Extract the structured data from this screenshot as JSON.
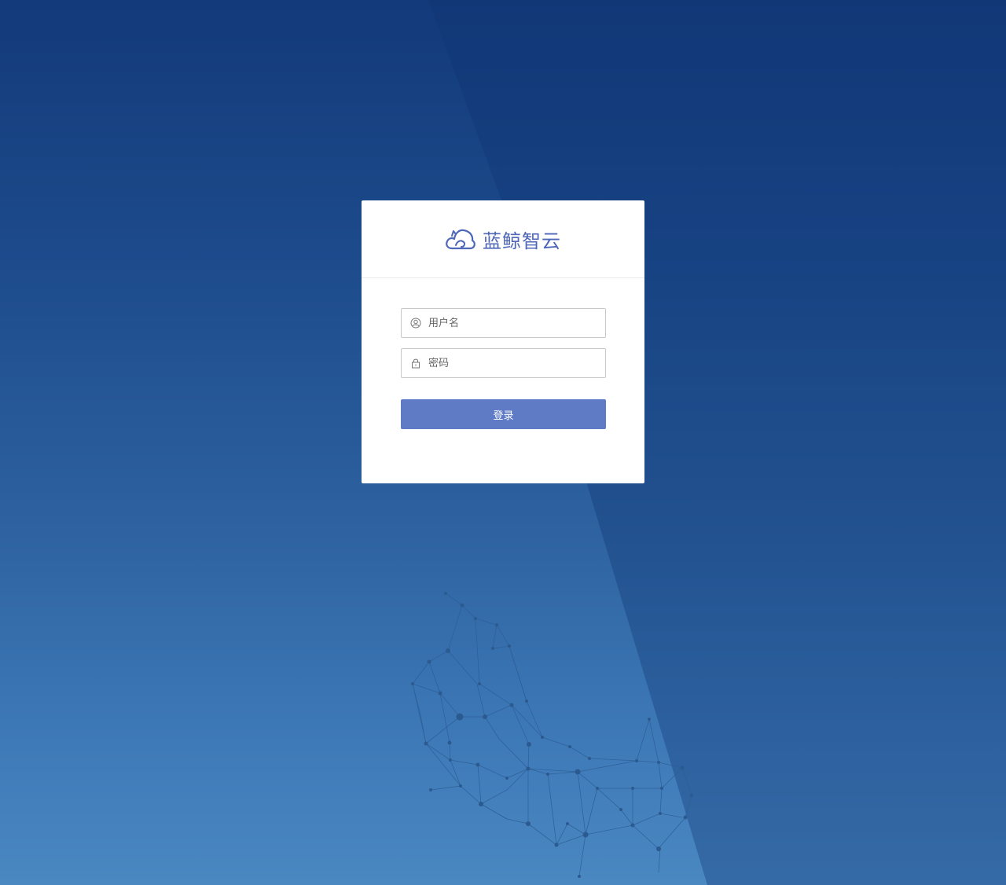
{
  "brand": {
    "name": "蓝鲸智云",
    "logo_icon": "cloud-icon",
    "color": "#4f67b8"
  },
  "login": {
    "username_placeholder": "用户名",
    "password_placeholder": "密码",
    "username_icon": "user-icon",
    "password_icon": "lock-icon",
    "submit_label": "登录",
    "button_color": "#5f7bc5"
  }
}
